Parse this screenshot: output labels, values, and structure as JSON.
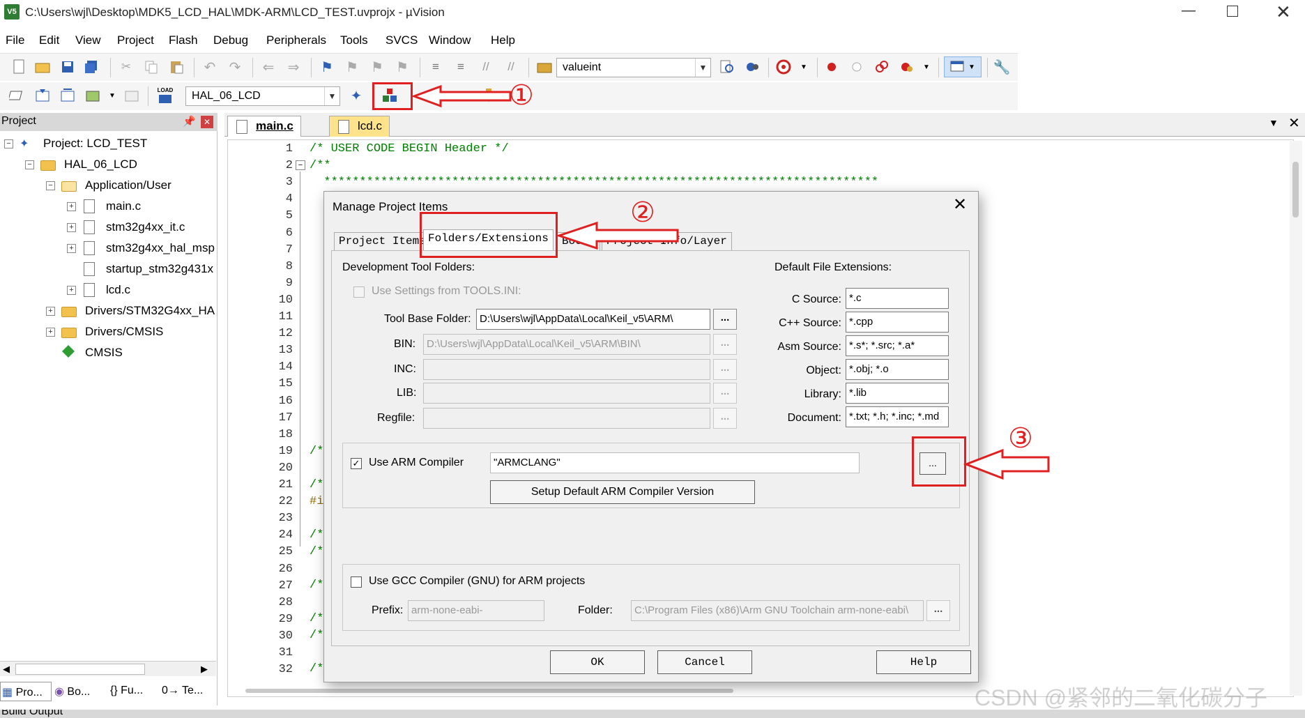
{
  "window": {
    "title": "C:\\Users\\wjl\\Desktop\\MDK5_LCD_HAL\\MDK-ARM\\LCD_TEST.uvprojx - µVision",
    "app_icon_label": "V5"
  },
  "menu": [
    "File",
    "Edit",
    "View",
    "Project",
    "Flash",
    "Debug",
    "Peripherals",
    "Tools",
    "SVCS",
    "Window",
    "Help"
  ],
  "toolbar": {
    "find_combo_value": "valueint",
    "target_combo_value": "HAL_06_LCD",
    "load_label": "LOAD"
  },
  "project_panel": {
    "header": "Project",
    "tree": [
      {
        "label": "Project: LCD_TEST"
      },
      {
        "label": "HAL_06_LCD"
      },
      {
        "label": "Application/User"
      },
      {
        "label": "main.c"
      },
      {
        "label": "stm32g4xx_it.c"
      },
      {
        "label": "stm32g4xx_hal_msp"
      },
      {
        "label": "startup_stm32g431x"
      },
      {
        "label": "lcd.c"
      },
      {
        "label": "Drivers/STM32G4xx_HA"
      },
      {
        "label": "Drivers/CMSIS"
      },
      {
        "label": "CMSIS"
      }
    ],
    "bottom_tabs": [
      "Pro...",
      "Bo...",
      "{} Fu...",
      "0→ Te..."
    ]
  },
  "editor": {
    "tabs": [
      "main.c",
      "lcd.c"
    ],
    "line_numbers": [
      "1",
      "2",
      "3",
      "4",
      "5",
      "6",
      "7",
      "8",
      "9",
      "10",
      "11",
      "12",
      "13",
      "14",
      "15",
      "16",
      "17",
      "18",
      "19",
      "20",
      "21",
      "22",
      "23",
      "24",
      "25",
      "26",
      "27",
      "28",
      "29",
      "30",
      "31",
      "32"
    ],
    "line1": "/* USER CODE BEGIN Header */",
    "line2": "/**",
    "line3": "  ******************************************************************************",
    "fragments": {
      "l19": "/*",
      "l21": "/*",
      "l22": "#i",
      "l24": "/*",
      "l25": "/*",
      "l27": "/*",
      "l29": "/*",
      "l30": "/*",
      "l32": "/*"
    }
  },
  "dialog": {
    "title": "Manage Project Items",
    "tabs": [
      "Project Items",
      "Folders/Extensions",
      "Books",
      "Project Info/Layer"
    ],
    "dev_folders_label": "Development Tool Folders:",
    "use_tools_ini": "Use Settings from TOOLS.INI:",
    "tool_base_label": "Tool Base Folder:",
    "tool_base_value": "D:\\Users\\wjl\\AppData\\Local\\Keil_v5\\ARM\\",
    "bin_label": "BIN:",
    "bin_value": "D:\\Users\\wjl\\AppData\\Local\\Keil_v5\\ARM\\BIN\\",
    "inc_label": "INC:",
    "lib_label": "LIB:",
    "regfile_label": "Regfile:",
    "default_ext_label": "Default File Extensions:",
    "extensions": [
      {
        "label": "C Source:",
        "value": "*.c"
      },
      {
        "label": "C++ Source:",
        "value": "*.cpp"
      },
      {
        "label": "Asm Source:",
        "value": "*.s*; *.src; *.a*"
      },
      {
        "label": "Object:",
        "value": "*.obj; *.o"
      },
      {
        "label": "Library:",
        "value": "*.lib"
      },
      {
        "label": "Document:",
        "value": "*.txt; *.h; *.inc; *.md"
      }
    ],
    "use_arm_compiler": "Use ARM Compiler",
    "arm_compiler_value": "\"ARMCLANG\"",
    "setup_default_button": "Setup Default ARM Compiler Version",
    "use_gcc": "Use GCC Compiler (GNU) for ARM projects",
    "prefix_label": "Prefix:",
    "prefix_value": "arm-none-eabi-",
    "folder_label": "Folder:",
    "folder_value": "C:\\Program Files (x86)\\Arm GNU Toolchain arm-none-eabi\\",
    "ok_button": "OK",
    "cancel_button": "Cancel",
    "help_button": "Help",
    "dots": "..."
  },
  "annotations": {
    "step1": "①",
    "step2": "②",
    "step3": "③"
  },
  "watermark": "CSDN @紧邻的二氧化碳分子",
  "status": {
    "build_output": "Build Output"
  },
  "colors": {
    "accent_red": "#e02020",
    "code_green": "#008000",
    "highlight_tab": "#ffe38a"
  }
}
